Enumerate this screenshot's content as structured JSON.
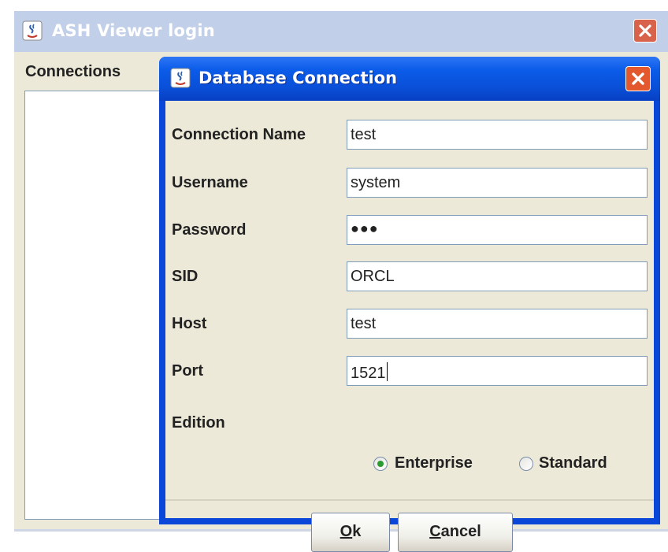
{
  "outer_window": {
    "title": "ASH Viewer login",
    "connections_label": "Connections"
  },
  "dialog": {
    "title": "Database Connection",
    "fields": {
      "connection_name": {
        "label": "Connection Name",
        "value": "test"
      },
      "username": {
        "label": "Username",
        "value": "system"
      },
      "password": {
        "label": "Password",
        "value": "●●●"
      },
      "sid": {
        "label": "SID",
        "value": "ORCL"
      },
      "host": {
        "label": "Host",
        "value": "test"
      },
      "port": {
        "label": "Port",
        "value": "1521"
      }
    },
    "edition": {
      "label": "Edition",
      "options": [
        {
          "label": "Enterprise",
          "selected": true
        },
        {
          "label": "Standard",
          "selected": false
        }
      ]
    },
    "buttons": {
      "ok": {
        "mnemonic": "O",
        "rest": "k"
      },
      "cancel": {
        "mnemonic": "C",
        "rest": "ancel"
      }
    }
  },
  "colors": {
    "dialog_title_bar": "#0a4fd8",
    "close_button": "#e3582c",
    "window_background": "#ece9d8",
    "radio_selected": "#2b9a30"
  },
  "icons": [
    "java-app-icon",
    "close-icon",
    "radio-selected-icon",
    "radio-unselected-icon"
  ]
}
